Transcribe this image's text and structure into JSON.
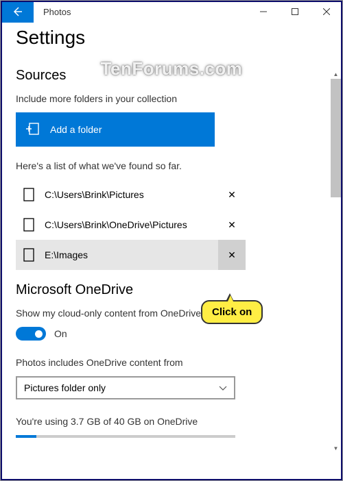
{
  "titlebar": {
    "app": "Photos"
  },
  "header": {
    "title": "Settings"
  },
  "watermark": "TenForums.com",
  "sources": {
    "title": "Sources",
    "include_text": "Include more folders in your collection",
    "add_label": "Add a folder",
    "list_text": "Here's a list of what we've found so far.",
    "folders": [
      {
        "path": "C:\\Users\\Brink\\Pictures"
      },
      {
        "path": "C:\\Users\\Brink\\OneDrive\\Pictures"
      },
      {
        "path": "E:\\Images"
      }
    ]
  },
  "onedrive": {
    "title": "Microsoft OneDrive",
    "show_text": "Show my cloud-only content from OneDrive",
    "toggle_state": "On",
    "includes_text": "Photos includes OneDrive content from",
    "dropdown_value": "Pictures folder only",
    "usage_text": "You're using 3.7 GB of 40 GB on OneDrive"
  },
  "callout": {
    "text": "Click on"
  }
}
